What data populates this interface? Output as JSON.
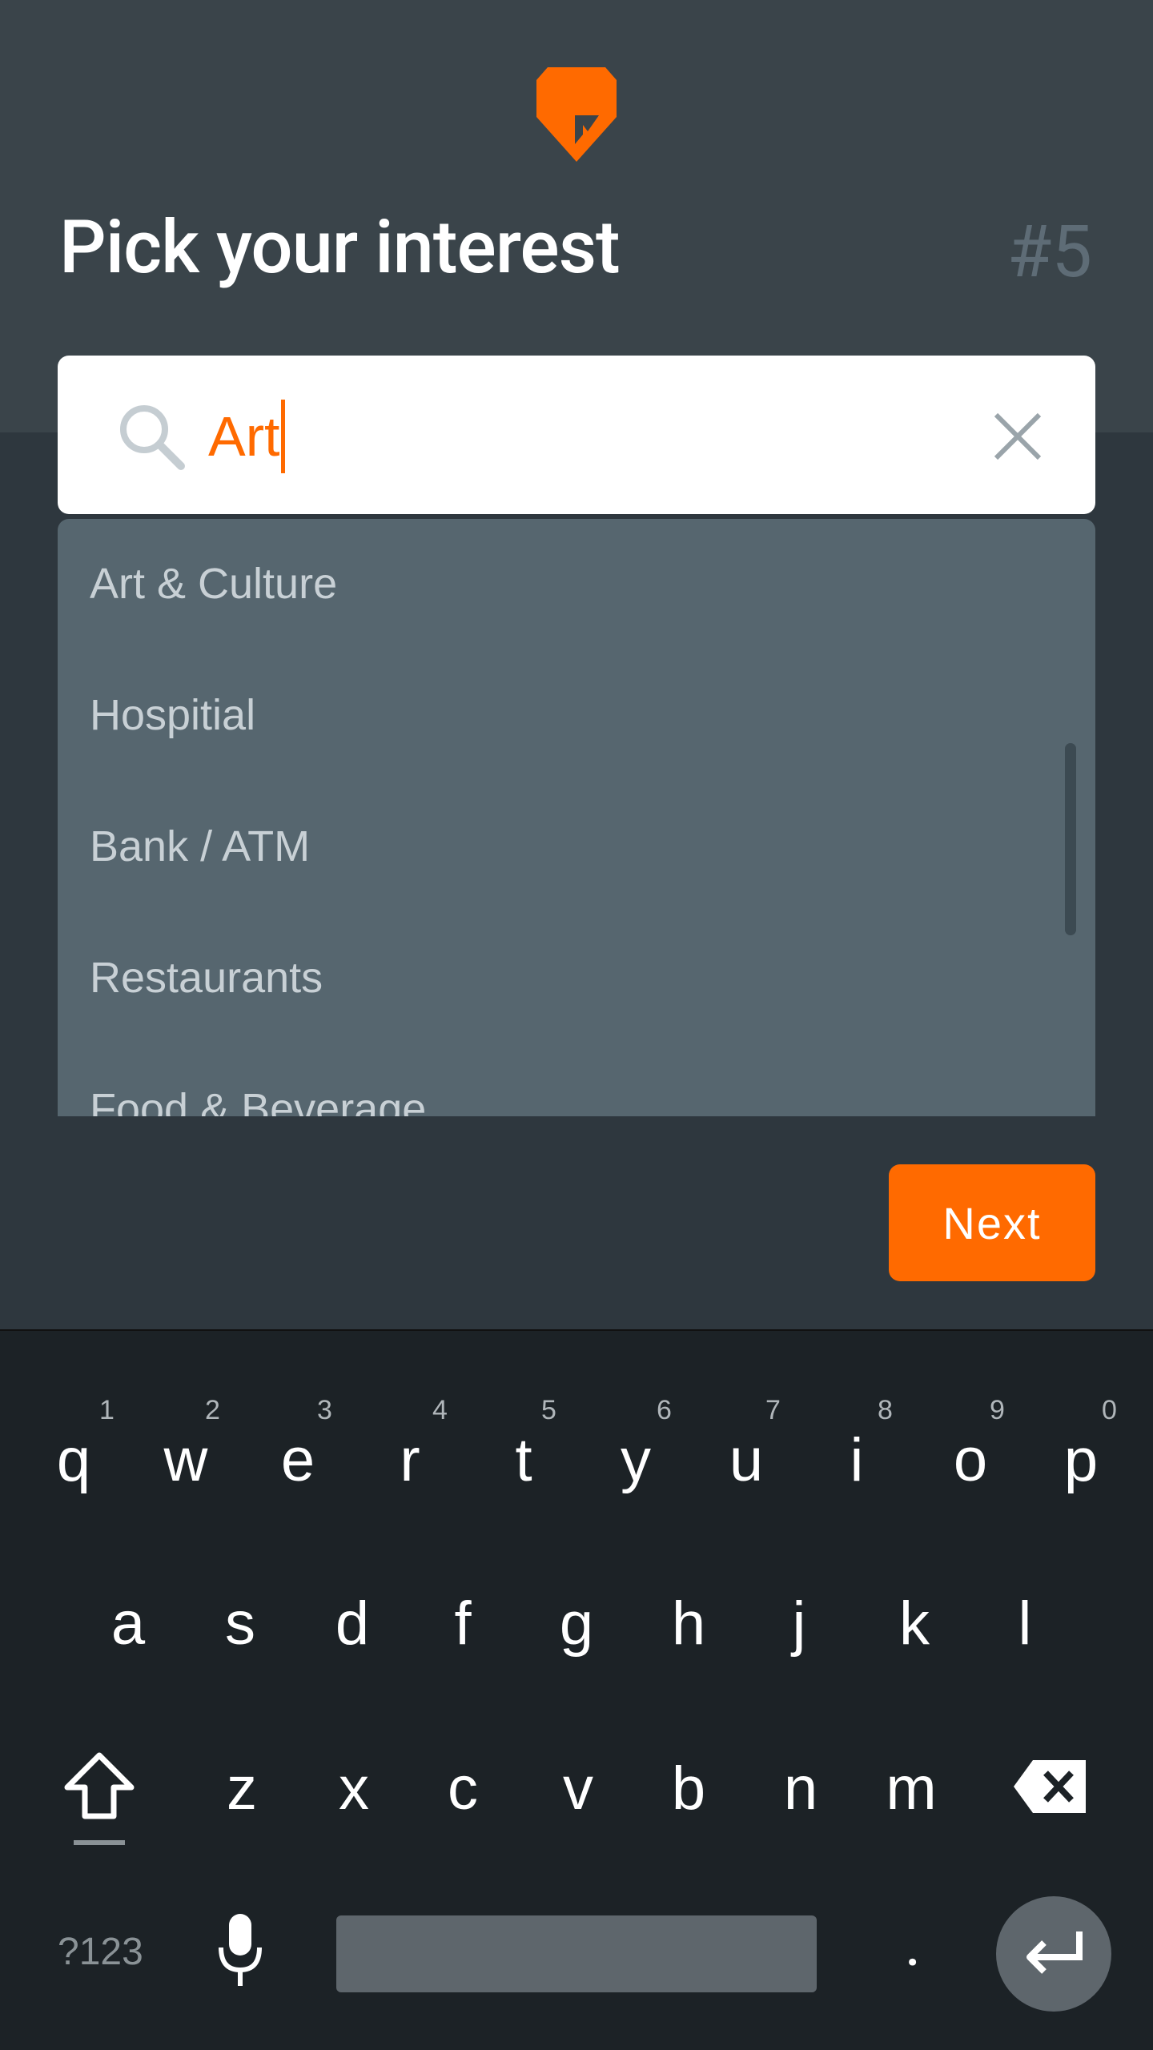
{
  "header": {
    "title": "Pick your interest",
    "step": "#5"
  },
  "search": {
    "value": "Art"
  },
  "suggestions": [
    "Art & Culture",
    "Hospitial",
    "Bank / ATM",
    "Restaurants",
    "Food & Beverage"
  ],
  "actions": {
    "next_label": "Next"
  },
  "keyboard": {
    "row1": [
      {
        "key": "q",
        "hint": "1"
      },
      {
        "key": "w",
        "hint": "2"
      },
      {
        "key": "e",
        "hint": "3"
      },
      {
        "key": "r",
        "hint": "4"
      },
      {
        "key": "t",
        "hint": "5"
      },
      {
        "key": "y",
        "hint": "6"
      },
      {
        "key": "u",
        "hint": "7"
      },
      {
        "key": "i",
        "hint": "8"
      },
      {
        "key": "o",
        "hint": "9"
      },
      {
        "key": "p",
        "hint": "0"
      }
    ],
    "row2": [
      "a",
      "s",
      "d",
      "f",
      "g",
      "h",
      "j",
      "k",
      "l"
    ],
    "row3": [
      "z",
      "x",
      "c",
      "v",
      "b",
      "n",
      "m"
    ],
    "symbols_label": "?123",
    "period_label": "."
  },
  "colors": {
    "accent": "#ff6a00",
    "header_bg": "#3a444a",
    "dropdown_bg": "#56666f",
    "keyboard_bg": "#1c2226"
  },
  "icons": {
    "logo": "map-pin-logo-icon",
    "search": "search-icon",
    "clear": "close-icon",
    "shift": "shift-icon",
    "backspace": "backspace-icon",
    "mic": "microphone-icon",
    "enter": "enter-icon"
  }
}
